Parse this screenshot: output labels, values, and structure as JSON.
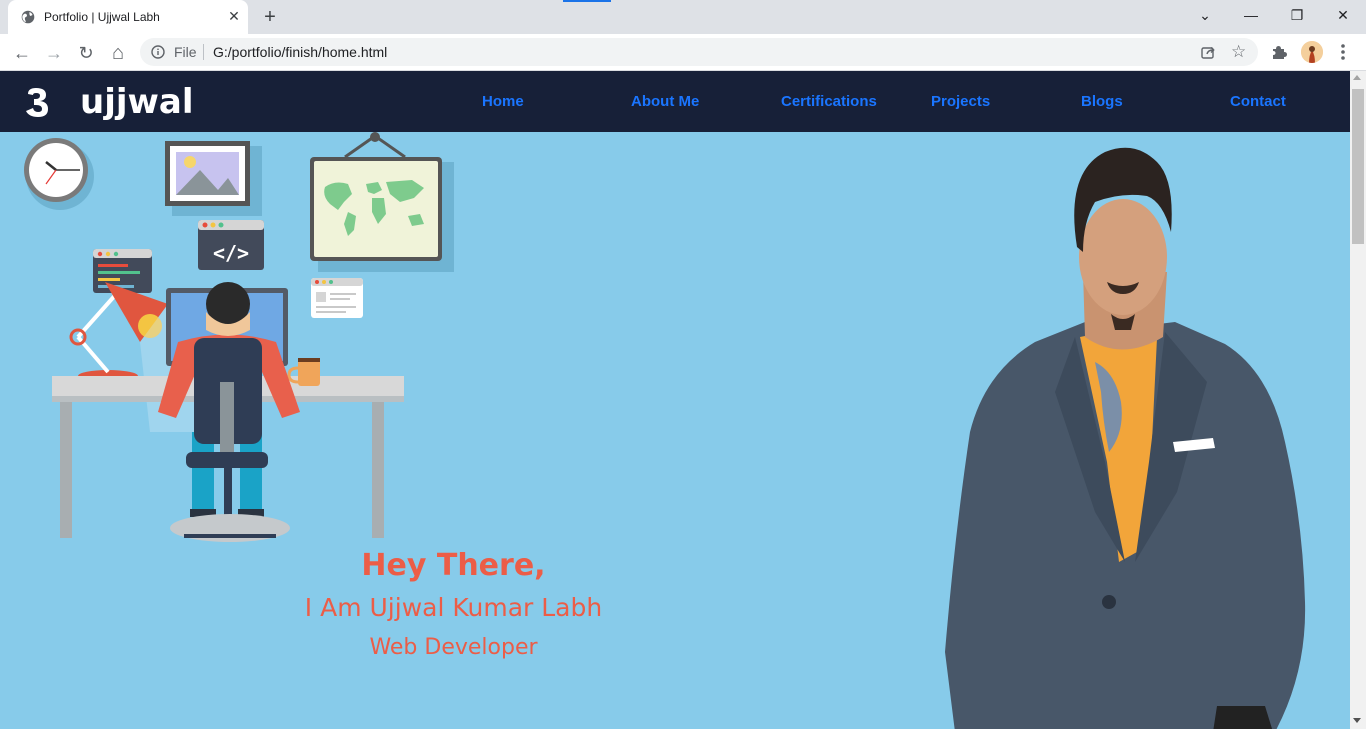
{
  "browser": {
    "tab_title": "Portfolio | Ujjwal Labh",
    "tab_close_glyph": "✕",
    "new_tab_glyph": "+",
    "window_buttons": [
      "⌄",
      "—",
      "❐",
      "✕"
    ],
    "nav_glyphs": {
      "back": "←",
      "forward": "→",
      "reload": "↻",
      "home": "⌂"
    },
    "omnibox_scheme": "File",
    "omnibox_url": "G:/portfolio/finish/home.html",
    "icons": [
      "globe-icon",
      "info-icon",
      "share-icon",
      "star-icon",
      "puzzle-icon",
      "profile-avatar",
      "menu-icon"
    ]
  },
  "site": {
    "logo_text": "ujjwal",
    "nav": [
      "Home",
      "About Me",
      "Certifications",
      "Projects",
      "Blogs",
      "Contact"
    ],
    "hero": {
      "greeting": "Hey There,",
      "name": "I Am Ujjwal Kumar Labh",
      "role": "Web Developer"
    },
    "colors": {
      "nav_bg": "#172038",
      "nav_link": "#1a75ff",
      "page_bg": "#87cbea",
      "hero_text": "#ec5d47"
    }
  }
}
